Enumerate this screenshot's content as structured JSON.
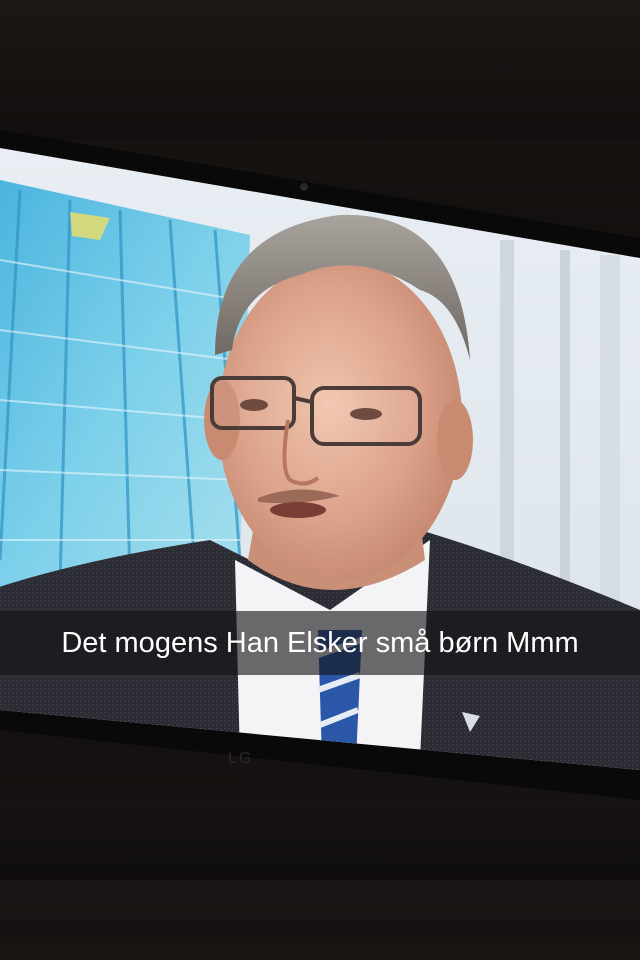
{
  "photo": {
    "subject": "television-showing-interview",
    "caption": "Det mogens Han Elsker små børn Mmm"
  },
  "colors": {
    "background": "#0c0a09",
    "screen_sky": "#5fc3e6",
    "jacket": "#2a2a30",
    "skin": "#d49c84",
    "hair": "#8a8480",
    "caption_bar": "rgba(20,18,20,0.62)",
    "caption_text": "#ffffff"
  }
}
